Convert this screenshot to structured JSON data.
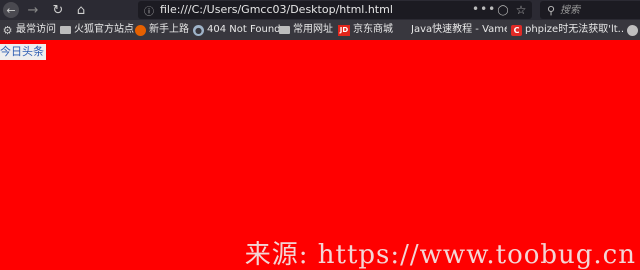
{
  "toolbar": {
    "url": "file:///C:/Users/Gmcc03/Desktop/html.html",
    "more": "•••",
    "search_placeholder": "搜索"
  },
  "bookmarks": [
    {
      "icon": "gear-icon",
      "label": "最常访问"
    },
    {
      "icon": "folder-icon",
      "label": "火狐官方站点"
    },
    {
      "icon": "firefox-icon",
      "label": "新手上路"
    },
    {
      "icon": "globe-icon",
      "label": "404 Not Found"
    },
    {
      "icon": "folder-icon",
      "label": "常用网址"
    },
    {
      "icon": "jd-icon",
      "label": "京东商城"
    },
    {
      "icon": "none",
      "label": "Java快速教程 - Vame..."
    },
    {
      "icon": "csdn-icon",
      "label": "phpize时无法获取'lt..."
    },
    {
      "icon": "chrome-icon",
      "label": ""
    }
  ],
  "page": {
    "link_text": "今日头条",
    "background_color": "#ff0000",
    "link_color": "#2f5fb3"
  },
  "watermark": "来源: https://www.toobug.cn"
}
